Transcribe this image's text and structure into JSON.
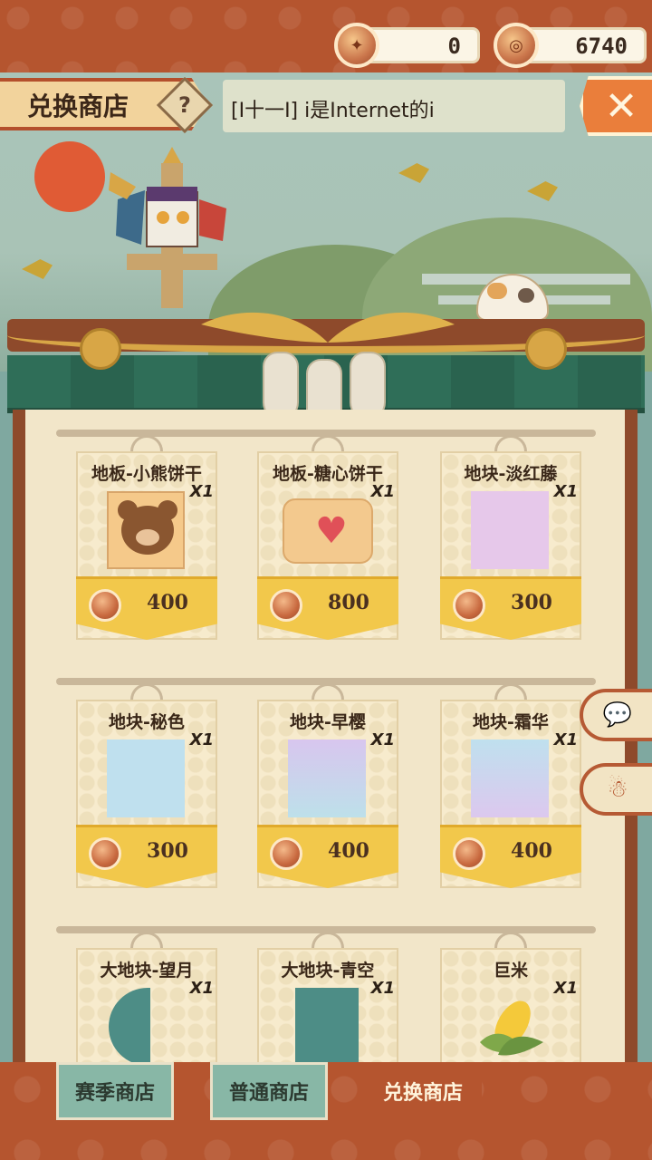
{
  "currencies": [
    {
      "name": "season-token",
      "value": "0"
    },
    {
      "name": "exchange-coin",
      "value": "6740"
    }
  ],
  "header": {
    "title": "兑换商店",
    "help_label": "?",
    "marquee": "[I十一I] i是Internet的i",
    "close_label": "✕"
  },
  "items": [
    {
      "name": "地板-小熊饼干",
      "qty": "X1",
      "price": "400",
      "thumb": "bear"
    },
    {
      "name": "地板-糖心饼干",
      "qty": "X1",
      "price": "800",
      "thumb": "heart"
    },
    {
      "name": "地块-淡红藤",
      "qty": "X1",
      "price": "300",
      "thumb_color": "#e6c8ea"
    },
    {
      "name": "地块-秘色",
      "qty": "X1",
      "price": "300",
      "thumb_color": "#bfe0ee"
    },
    {
      "name": "地块-早樱",
      "qty": "X1",
      "price": "400",
      "thumb_color": "#d6c6ee"
    },
    {
      "name": "地块-霜华",
      "qty": "X1",
      "price": "400",
      "thumb_color": "#d2d6f0"
    },
    {
      "name": "大地块-望月",
      "qty": "X1",
      "price": "",
      "thumb_color": "#4d8d86"
    },
    {
      "name": "大地块-青空",
      "qty": "X1",
      "price": "",
      "thumb_color": "#4d8d86"
    },
    {
      "name": "巨米",
      "qty": "X1",
      "price": "",
      "thumb": "corn"
    }
  ],
  "tabs": [
    {
      "label": "赛季商店",
      "active": false
    },
    {
      "label": "普通商店",
      "active": false
    },
    {
      "label": "兑换商店",
      "active": true
    }
  ],
  "colors": {
    "brand_red": "#b5552f",
    "gold": "#f2c84b",
    "teal": "#88b7a6"
  }
}
